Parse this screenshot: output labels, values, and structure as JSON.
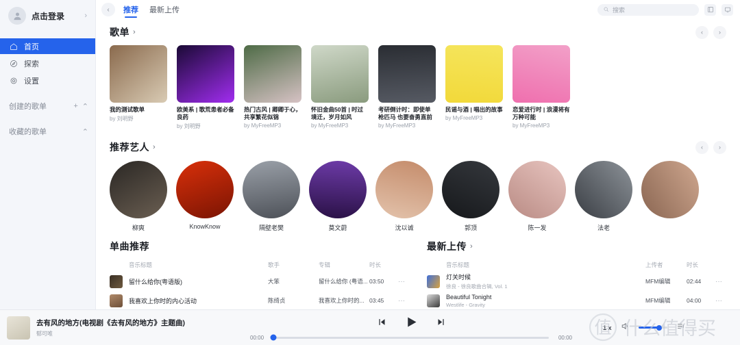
{
  "sidebar": {
    "login_label": "点击登录",
    "login_chevron": "›",
    "nav": [
      {
        "label": "首页",
        "icon": "home-icon",
        "active": true
      },
      {
        "label": "探索",
        "icon": "compass-icon",
        "active": false
      },
      {
        "label": "设置",
        "icon": "gear-icon",
        "active": false
      }
    ],
    "groups": [
      {
        "label": "创建的歌单",
        "add": "+",
        "collapse": "⌃"
      },
      {
        "label": "收藏的歌单",
        "add": "",
        "collapse": "⌃"
      }
    ]
  },
  "topbar": {
    "back": "‹",
    "tabs": [
      {
        "label": "推荐",
        "active": true
      },
      {
        "label": "最新上传",
        "active": false
      }
    ],
    "search_placeholder": "搜索",
    "icons": [
      "mini-player-icon",
      "cast-icon"
    ]
  },
  "playlists_section": {
    "title": "歌单",
    "arrow": "›",
    "prev": "‹",
    "next": "›",
    "items": [
      {
        "name": "我的测试歌单",
        "by": "by 刘明野",
        "c1": "#8a6a4d",
        "c2": "#d9cbb4"
      },
      {
        "name": "欧美系 | 歌荒患者必备良药",
        "by": "by 刘明野",
        "c1": "#1a0a35",
        "c2": "#a12df0"
      },
      {
        "name": "热门古风 | 卿卿于心，共享繁花似锦",
        "by": "by MyFreeMP3",
        "c1": "#4e6b46",
        "c2": "#d6c2c4"
      },
      {
        "name": "怀旧金曲50首 | 时过境迁，岁月如风",
        "by": "by MyFreeMP3",
        "c1": "#cfd8c8",
        "c2": "#8a9b7e"
      },
      {
        "name": "考研倒计时：即使单枪匹马 也要奋勇直前",
        "by": "by MyFreeMP3",
        "c1": "#2a2d33",
        "c2": "#565a63"
      },
      {
        "name": "民谣与酒 | 唱出的故事",
        "by": "by MyFreeMP3",
        "c1": "#f5e55c",
        "c2": "#f2d93a"
      },
      {
        "name": "恋爱进行时 | 浪漫将有万种可能",
        "by": "by MyFreeMP3",
        "c1": "#f2a0c8",
        "c2": "#ef6fae"
      }
    ]
  },
  "artists_section": {
    "title": "推荐艺人",
    "arrow": "›",
    "prev": "‹",
    "next": "›",
    "items": [
      {
        "name": "柳爽",
        "c1": "#2a2724",
        "c2": "#6b5f52"
      },
      {
        "name": "KnowKnow",
        "c1": "#d9300a",
        "c2": "#7a1403"
      },
      {
        "name": "隔壁老樊",
        "c1": "#9aa0a8",
        "c2": "#4d5158"
      },
      {
        "name": "莫文蔚",
        "c1": "#6d3ba8",
        "c2": "#2a1146"
      },
      {
        "name": "沈以诚",
        "c1": "#c48b6a",
        "c2": "#e3c3ac"
      },
      {
        "name": "郭顶",
        "c1": "#35383d",
        "c2": "#16181b"
      },
      {
        "name": "陈一发",
        "c1": "#e8c5c0",
        "c2": "#b98b84"
      },
      {
        "name": "法老",
        "c1": "#8d9399",
        "c2": "#3a3e44"
      },
      {
        "name": "",
        "c1": "#cfa78f",
        "c2": "#8a6652"
      }
    ]
  },
  "recommend_list": {
    "title": "单曲推荐",
    "columns": {
      "title": "音乐标题",
      "artist": "歌手",
      "album": "专辑",
      "duration": "时长"
    },
    "more_glyph": "···",
    "rows": [
      {
        "title": "留什么给你(粤语版)",
        "artist": "大笨",
        "album": "留什么给你 (粤语...",
        "duration": "03:50",
        "c1": "#3a2f24",
        "c2": "#6e5a3f"
      },
      {
        "title": "我喜欢上你时的内心活动",
        "artist": "陈绮贞",
        "album": "我喜欢上你时的...",
        "duration": "03:45",
        "c1": "#b08a6a",
        "c2": "#6d4f38"
      },
      {
        "title": "",
        "artist": "",
        "album": "",
        "duration": "",
        "c1": "#8e2f22",
        "c2": "#d94f34"
      }
    ]
  },
  "latest_list": {
    "title": "最新上传",
    "arrow": "›",
    "columns": {
      "title": "音乐标题",
      "uploader": "上传者",
      "duration": "时长"
    },
    "more_glyph": "···",
    "rows": [
      {
        "title": "灯关时候",
        "sub": "徐良 - 徐良歌曲合辑, Vol. 1",
        "uploader": "MFM编辑",
        "duration": "02:44",
        "c1": "#3f6fd8",
        "c2": "#d8a23f"
      },
      {
        "title": "Beautiful Tonight",
        "sub": "Westlife - Gravity",
        "uploader": "MFM编辑",
        "duration": "04:00",
        "c1": "#dcdcdc",
        "c2": "#3a3a3a"
      },
      {
        "title": "",
        "sub": "",
        "uploader": "",
        "duration": "",
        "c1": "#9fb4c9",
        "c2": "#4a5d70"
      }
    ]
  },
  "player": {
    "song_title": "去有风的地方(电视剧《去有风的地方》主题曲)",
    "artist": "郁可唯",
    "elapsed": "00:00",
    "total": "00:00",
    "speed": "1 x",
    "prev_icon": "skip-previous-icon",
    "play_icon": "play-icon",
    "next_icon": "skip-next-icon",
    "volume_icon": "volume-icon",
    "list_icon": "playlist-icon",
    "progress_percent": 0,
    "volume_percent": 72,
    "cover_c1": "#e8e4d8",
    "cover_c2": "#c9c4b2"
  },
  "watermark": {
    "text": "什么值得买"
  },
  "colors": {
    "accent": "#2563eb",
    "sidebar_bg": "#f4f6fa",
    "player_bg": "#f7f8fa"
  }
}
